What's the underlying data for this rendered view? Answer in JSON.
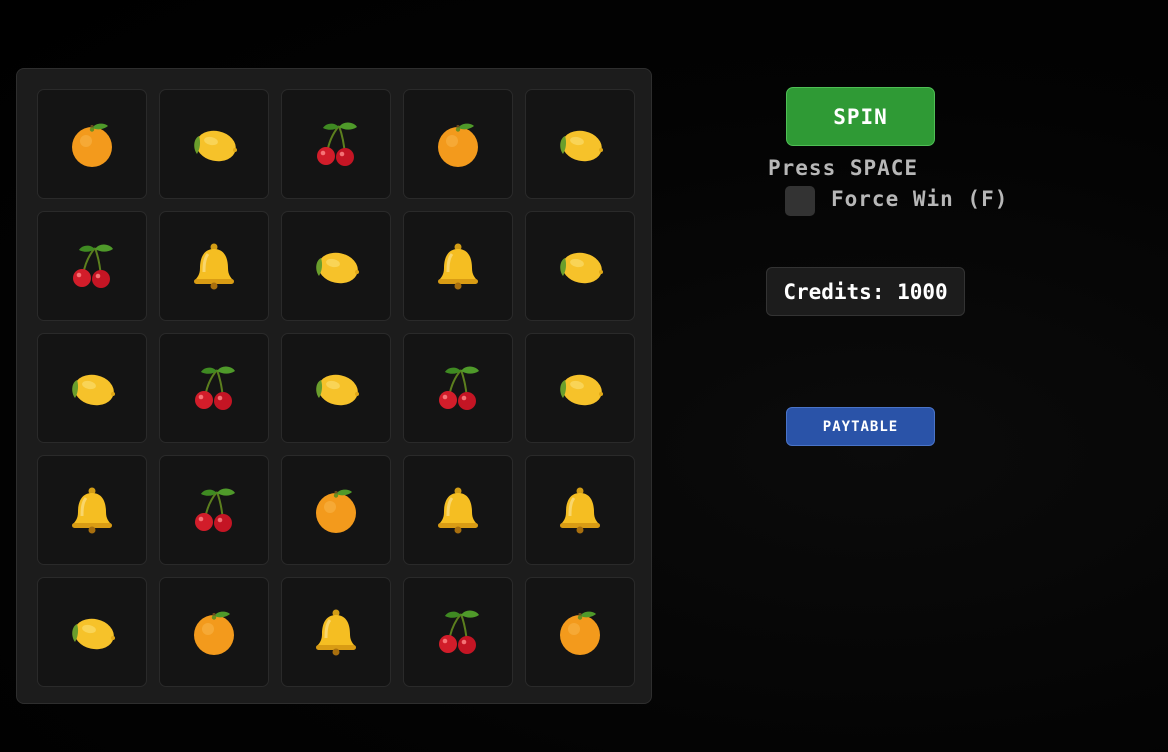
{
  "grid": {
    "rows": 5,
    "columns": 5,
    "symbols": [
      [
        "orange",
        "lemon",
        "cherry",
        "orange",
        "lemon"
      ],
      [
        "cherry",
        "bell",
        "lemon",
        "bell",
        "lemon"
      ],
      [
        "lemon",
        "cherry",
        "lemon",
        "cherry",
        "lemon"
      ],
      [
        "bell",
        "cherry",
        "orange",
        "bell",
        "bell"
      ],
      [
        "lemon",
        "orange",
        "bell",
        "cherry",
        "orange"
      ]
    ]
  },
  "controls": {
    "spin_label": "SPIN",
    "spin_hint": "Press SPACE",
    "force_win_label": "Force Win (F)",
    "force_win_checked": false,
    "credits_label": "Credits: 1000",
    "paytable_label": "PAYTABLE"
  },
  "colors": {
    "spin_button": "#2f9a35",
    "paytable_button": "#2a53a8",
    "board": "#1c1c1c",
    "cell": "#141414"
  },
  "icons": {
    "orange": "orange-icon",
    "lemon": "lemon-icon",
    "cherry": "cherry-icon",
    "bell": "bell-icon"
  }
}
